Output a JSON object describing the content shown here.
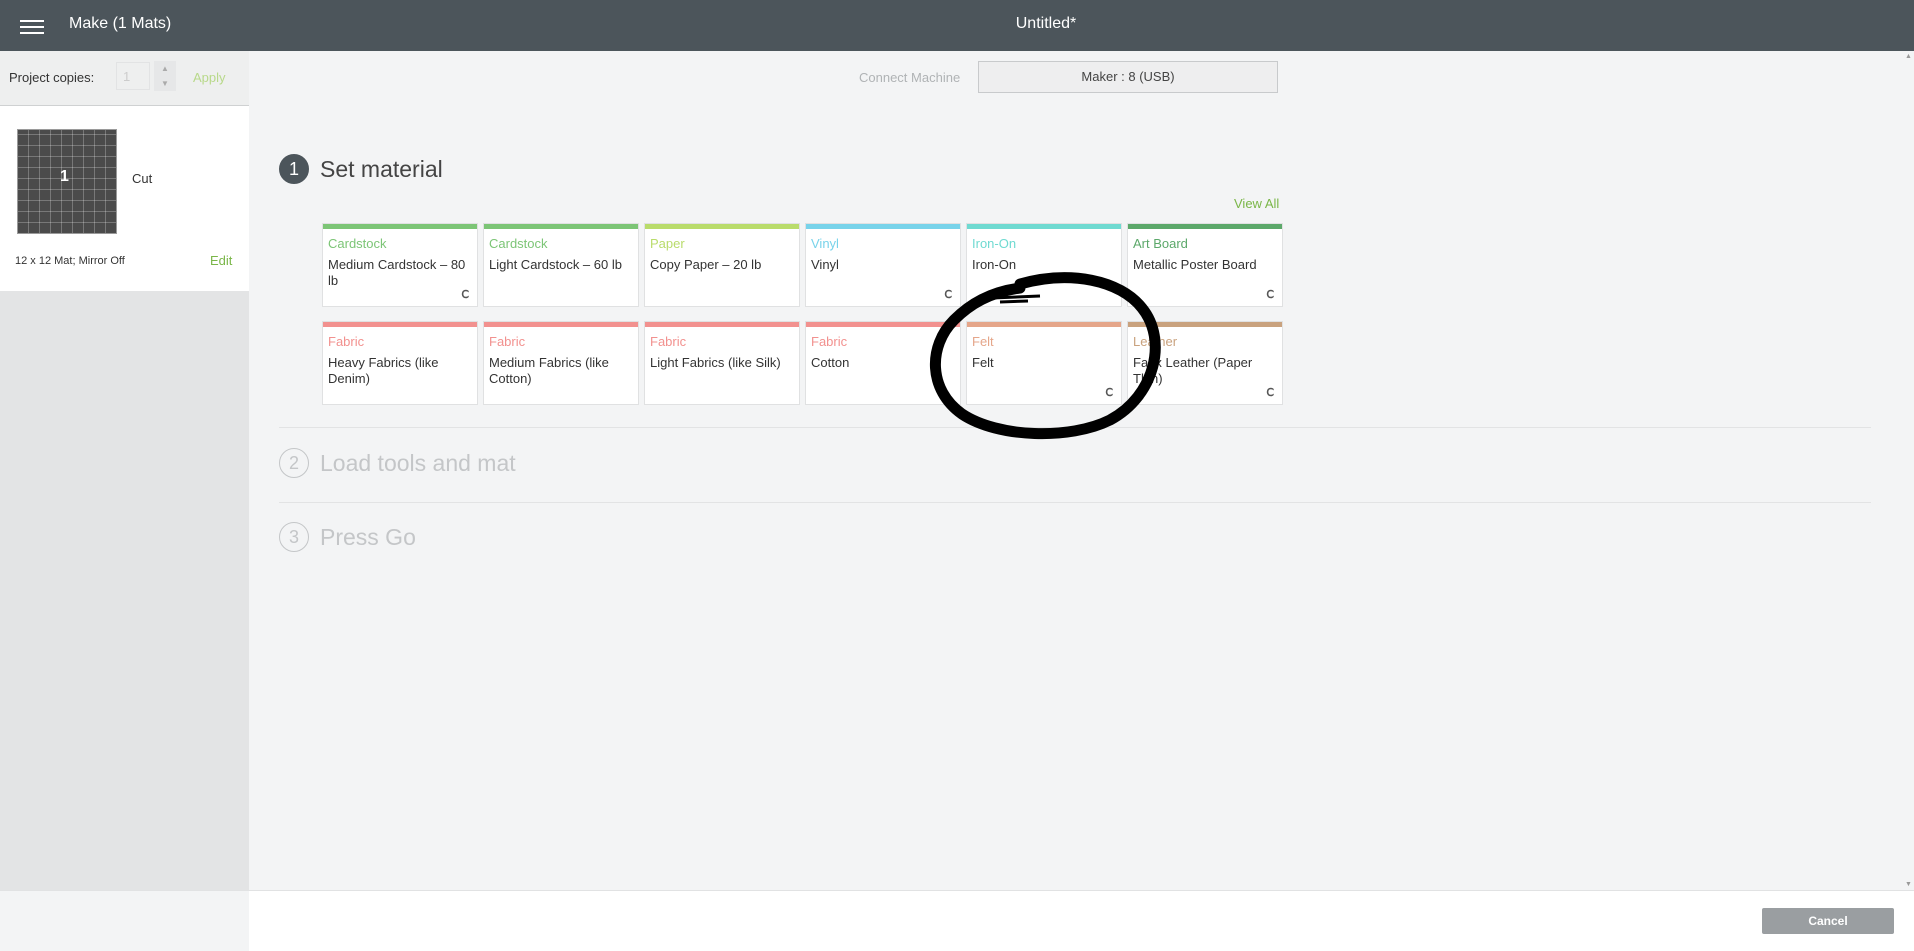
{
  "header": {
    "make_title": "Make (1 Mats)",
    "doc_title": "Untitled*"
  },
  "sidebar": {
    "copies_label": "Project copies:",
    "copies_value": "1",
    "apply_label": "Apply",
    "mat": {
      "thumb_number": "1",
      "mode": "Cut",
      "info": "12 x 12 Mat; Mirror Off",
      "edit_label": "Edit"
    }
  },
  "connect": {
    "label": "Connect Machine",
    "machine": "Maker : 8 (USB)"
  },
  "steps": [
    {
      "number": "1",
      "title": "Set material"
    },
    {
      "number": "2",
      "title": "Load tools and mat"
    },
    {
      "number": "3",
      "title": "Press Go"
    }
  ],
  "view_all_label": "View All",
  "materials": [
    {
      "category": "Cardstock",
      "name": "Medium Cardstock – 80 lb",
      "color": "#7cc576",
      "has_icon": true
    },
    {
      "category": "Cardstock",
      "name": "Light Cardstock – 60 lb",
      "color": "#7cc576",
      "has_icon": false
    },
    {
      "category": "Paper",
      "name": "Copy Paper – 20 lb",
      "color": "#b9dc6b",
      "has_icon": false
    },
    {
      "category": "Vinyl",
      "name": "Vinyl",
      "color": "#78d3ea",
      "has_icon": true
    },
    {
      "category": "Iron-On",
      "name": "Iron-On",
      "color": "#6fdad1",
      "has_icon": false
    },
    {
      "category": "Art Board",
      "name": "Metallic Poster Board",
      "color": "#5ca86a",
      "has_icon": true
    },
    {
      "category": "Fabric",
      "name": "Heavy Fabrics (like Denim)",
      "color": "#f2918f",
      "has_icon": false
    },
    {
      "category": "Fabric",
      "name": "Medium Fabrics (like Cotton)",
      "color": "#f2918f",
      "has_icon": false
    },
    {
      "category": "Fabric",
      "name": "Light Fabrics (like Silk)",
      "color": "#f2918f",
      "has_icon": false
    },
    {
      "category": "Fabric",
      "name": "Cotton",
      "color": "#f2918f",
      "has_icon": false
    },
    {
      "category": "Felt",
      "name": "Felt",
      "color": "#e5a68a",
      "has_icon": true
    },
    {
      "category": "Leather",
      "name": "Faux Leather (Paper Thin)",
      "color": "#c9a27e",
      "has_icon": true
    }
  ],
  "footer": {
    "cancel_label": "Cancel"
  },
  "colors": {
    "accent": "#7ab648",
    "topbar": "#4c555b"
  }
}
